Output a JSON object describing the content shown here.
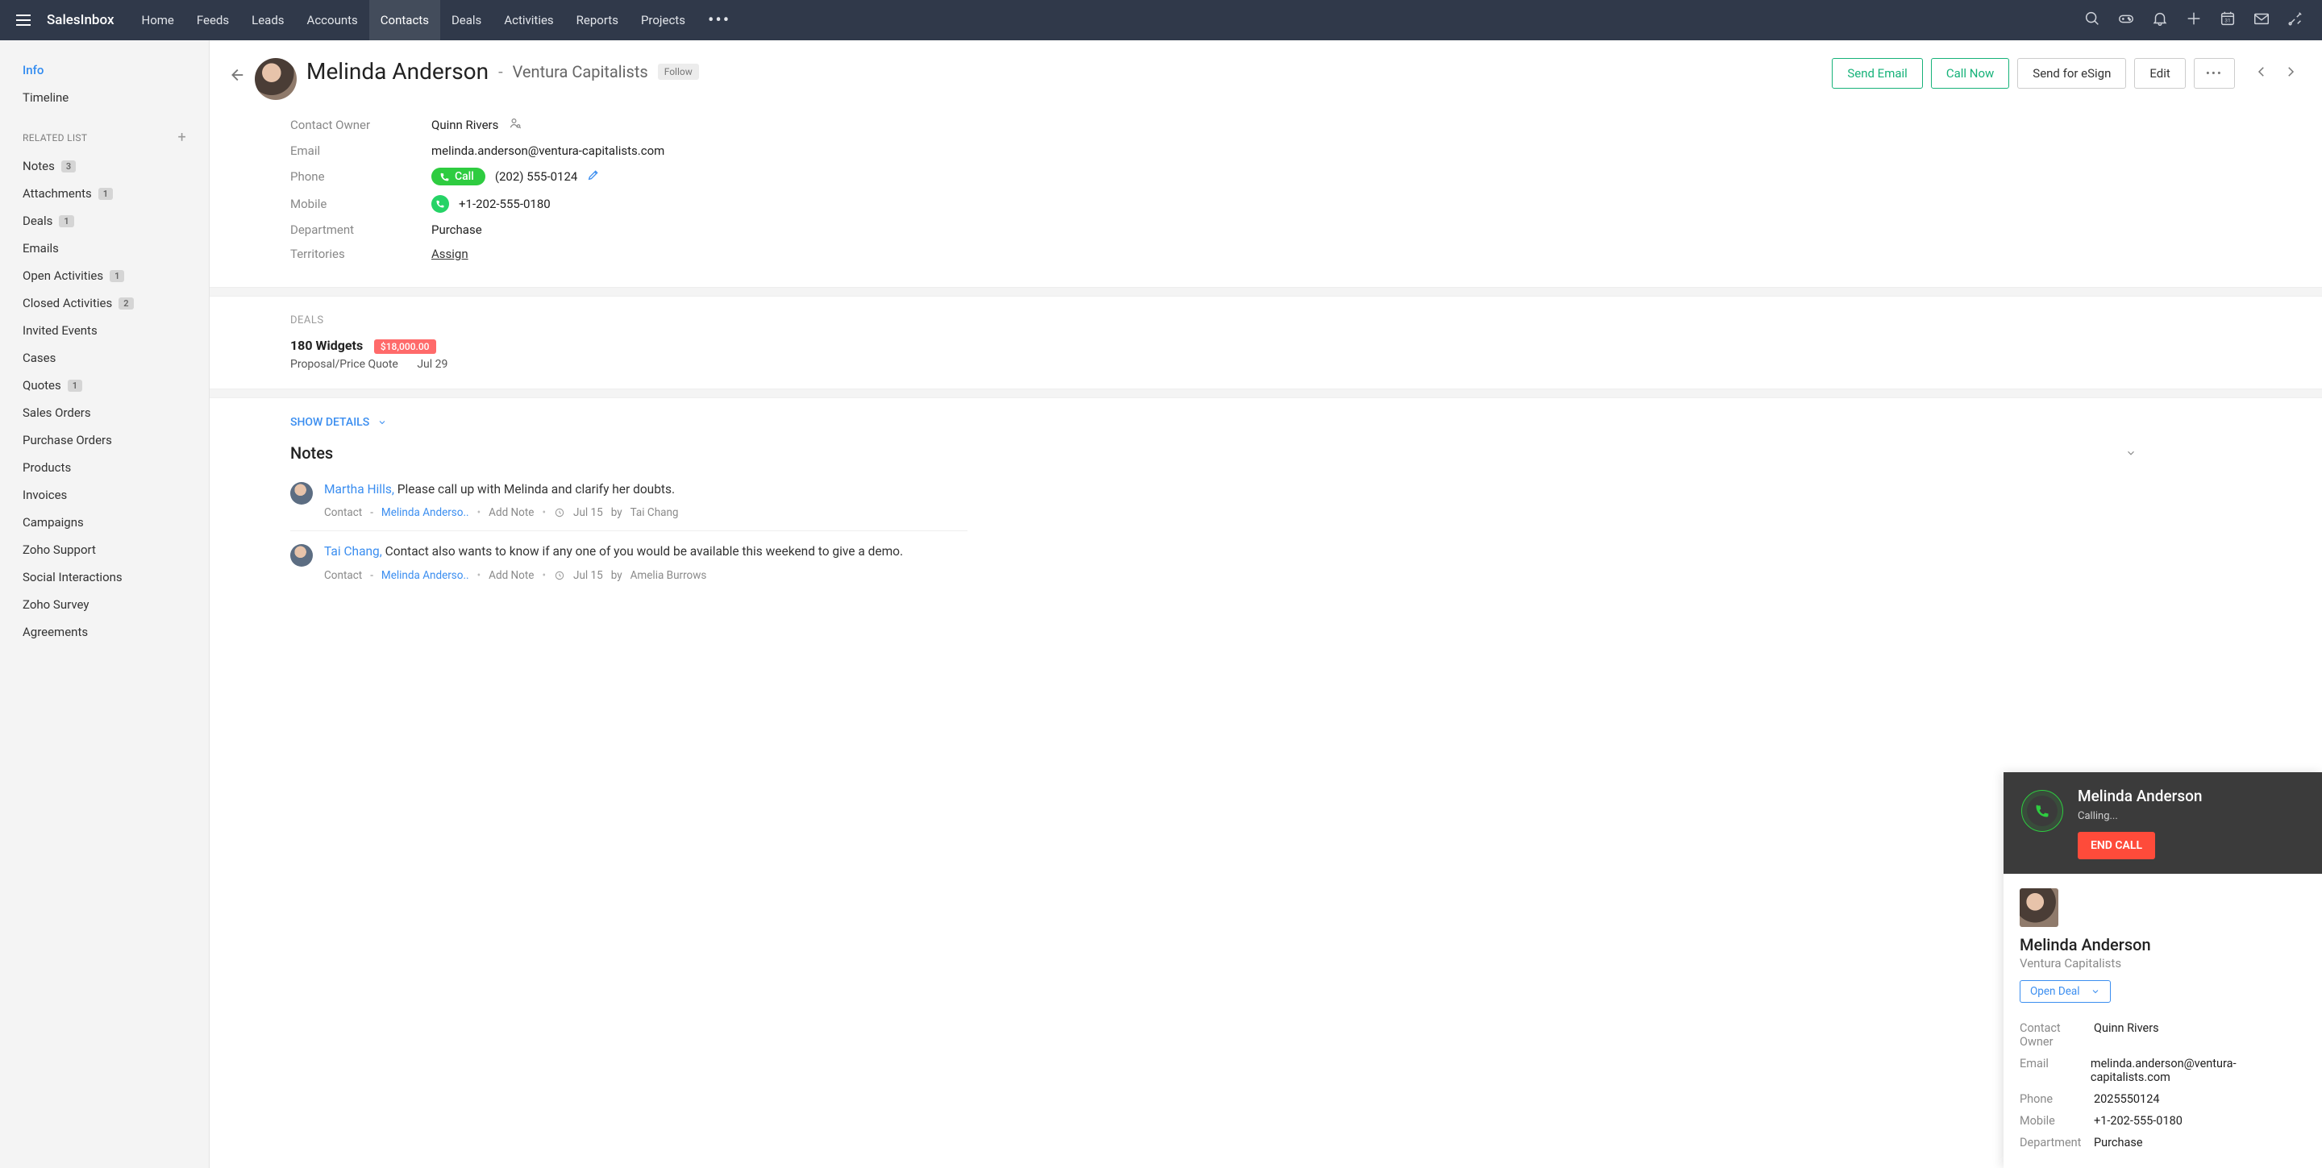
{
  "brand": "SalesInbox",
  "nav_tabs": [
    "Home",
    "Feeds",
    "Leads",
    "Accounts",
    "Contacts",
    "Deals",
    "Activities",
    "Reports",
    "Projects"
  ],
  "nav_active": "Contacts",
  "nav_more": "•••",
  "sidebar": {
    "primary": [
      {
        "label": "Info",
        "selected": true
      },
      {
        "label": "Timeline"
      }
    ],
    "related_heading": "RELATED LIST",
    "related": [
      {
        "label": "Notes",
        "badge": "3"
      },
      {
        "label": "Attachments",
        "badge": "1"
      },
      {
        "label": "Deals",
        "badge": "1"
      },
      {
        "label": "Emails"
      },
      {
        "label": "Open Activities",
        "badge": "1"
      },
      {
        "label": "Closed Activities",
        "badge": "2"
      },
      {
        "label": "Invited Events"
      },
      {
        "label": "Cases"
      },
      {
        "label": "Quotes",
        "badge": "1"
      },
      {
        "label": "Sales Orders"
      },
      {
        "label": "Purchase Orders"
      },
      {
        "label": "Products"
      },
      {
        "label": "Invoices"
      },
      {
        "label": "Campaigns"
      },
      {
        "label": "Zoho Support"
      },
      {
        "label": "Social Interactions"
      },
      {
        "label": "Zoho Survey"
      },
      {
        "label": "Agreements"
      }
    ]
  },
  "contact": {
    "name": "Melinda Anderson",
    "company": "Ventura Capitalists",
    "follow": "Follow"
  },
  "header_actions": {
    "send_email": "Send Email",
    "call_now": "Call Now",
    "send_esign": "Send for eSign",
    "edit": "Edit",
    "more": "•••"
  },
  "fields": {
    "contact_owner": {
      "label": "Contact Owner",
      "value": "Quinn Rivers"
    },
    "email": {
      "label": "Email",
      "value": "melinda.anderson@ventura-capitalists.com"
    },
    "phone": {
      "label": "Phone",
      "call_label": "Call",
      "value": "(202) 555-0124"
    },
    "mobile": {
      "label": "Mobile",
      "value": "+1-202-555-0180"
    },
    "department": {
      "label": "Department",
      "value": "Purchase"
    },
    "territories": {
      "label": "Territories",
      "assign": "Assign"
    }
  },
  "deals": {
    "heading": "DEALS",
    "name": "180 Widgets",
    "amount": "$18,000.00",
    "stage": "Proposal/Price Quote",
    "date": "Jul 29"
  },
  "details_toggle": "SHOW DETAILS",
  "notes_heading": "Notes",
  "notes": [
    {
      "author": "Martha Hills,",
      "text": "Please call up with Melinda and clarify her doubts.",
      "meta_module": "Contact",
      "meta_link": "Melinda Anderso..",
      "add_note": "Add Note",
      "date": "Jul 15",
      "by": "by",
      "owner": "Tai Chang"
    },
    {
      "author": "Tai Chang,",
      "text": "Contact also wants to know if any one of you would be available this weekend to give a demo.",
      "meta_module": "Contact",
      "meta_link": "Melinda Anderso..",
      "add_note": "Add Note",
      "date": "Jul 15",
      "by": "by",
      "owner": "Amelia Burrows"
    }
  ],
  "call_panel": {
    "title": "Melinda Anderson",
    "status": "Calling...",
    "end_call": "END CALL",
    "name": "Melinda Anderson",
    "company": "Ventura Capitalists",
    "open_deal": "Open Deal",
    "rows": {
      "owner": {
        "label": "Contact Owner",
        "value": "Quinn Rivers"
      },
      "email": {
        "label": "Email",
        "value": "melinda.anderson@ventura-capitalists.com"
      },
      "phone": {
        "label": "Phone",
        "value": "2025550124"
      },
      "mobile": {
        "label": "Mobile",
        "value": "+1-202-555-0180"
      },
      "department": {
        "label": "Department",
        "value": "Purchase"
      }
    }
  }
}
